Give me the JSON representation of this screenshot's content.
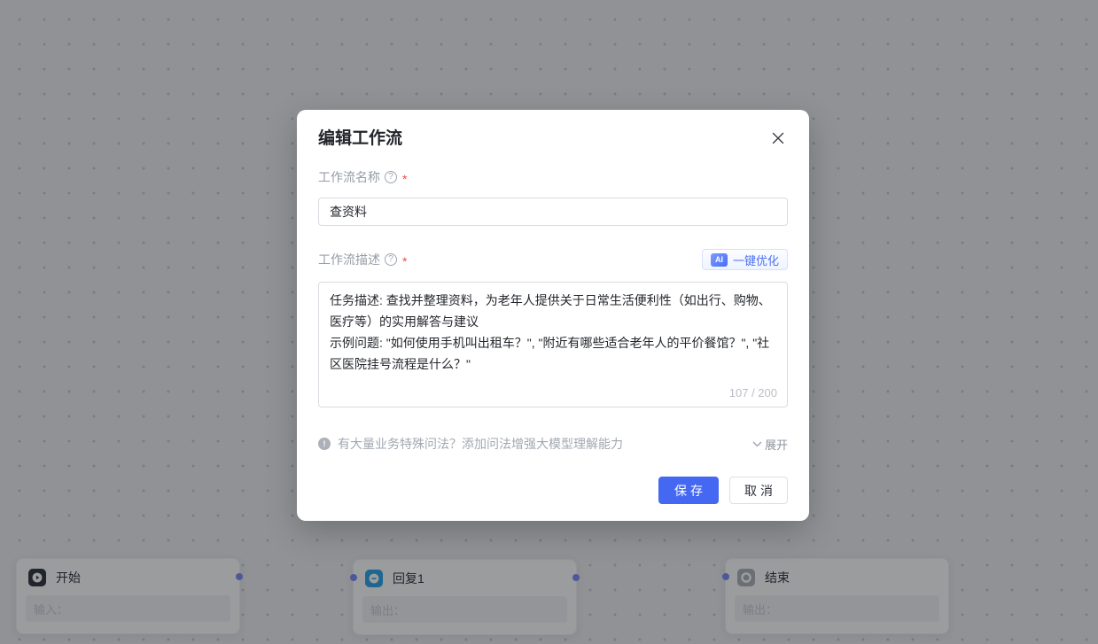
{
  "dialog": {
    "title": "编辑工作流",
    "name_field": {
      "label": "工作流名称",
      "required_mark": "*",
      "value": "查资料"
    },
    "desc_field": {
      "label": "工作流描述",
      "required_mark": "*",
      "value": "任务描述: 查找并整理资料，为老年人提供关于日常生活便利性（如出行、购物、医疗等）的实用解答与建议\n示例问题: \"如何使用手机叫出租车？\", \"附近有哪些适合老年人的平价餐馆？\", \"社区医院挂号流程是什么？\"",
      "counter": "107 / 200"
    },
    "ai_optimize": {
      "badge": "AI",
      "label": "一键优化"
    },
    "hint": {
      "text": "有大量业务特殊问法？添加问法增强大模型理解能力",
      "expand_label": "展开"
    },
    "buttons": {
      "save": "保存",
      "cancel": "取消"
    }
  },
  "icons": {
    "help_glyph": "?",
    "info_glyph": "!"
  },
  "canvas": {
    "nodes": [
      {
        "title": "开始",
        "field_label": "输入：",
        "icon": "play-icon"
      },
      {
        "title": "回复1",
        "field_label": "输出：",
        "icon": "chat-icon"
      },
      {
        "title": "结束",
        "field_label": "输出：",
        "icon": "stop-icon"
      }
    ]
  },
  "colors": {
    "accent_blue": "#4568f2",
    "ai_text_blue": "#4e6ff6",
    "required_red": "#f24c43",
    "canvas_bg": "#eaecef",
    "chat_icon_blue": "#2ba2e8",
    "port_blue": "#7c8af0"
  }
}
